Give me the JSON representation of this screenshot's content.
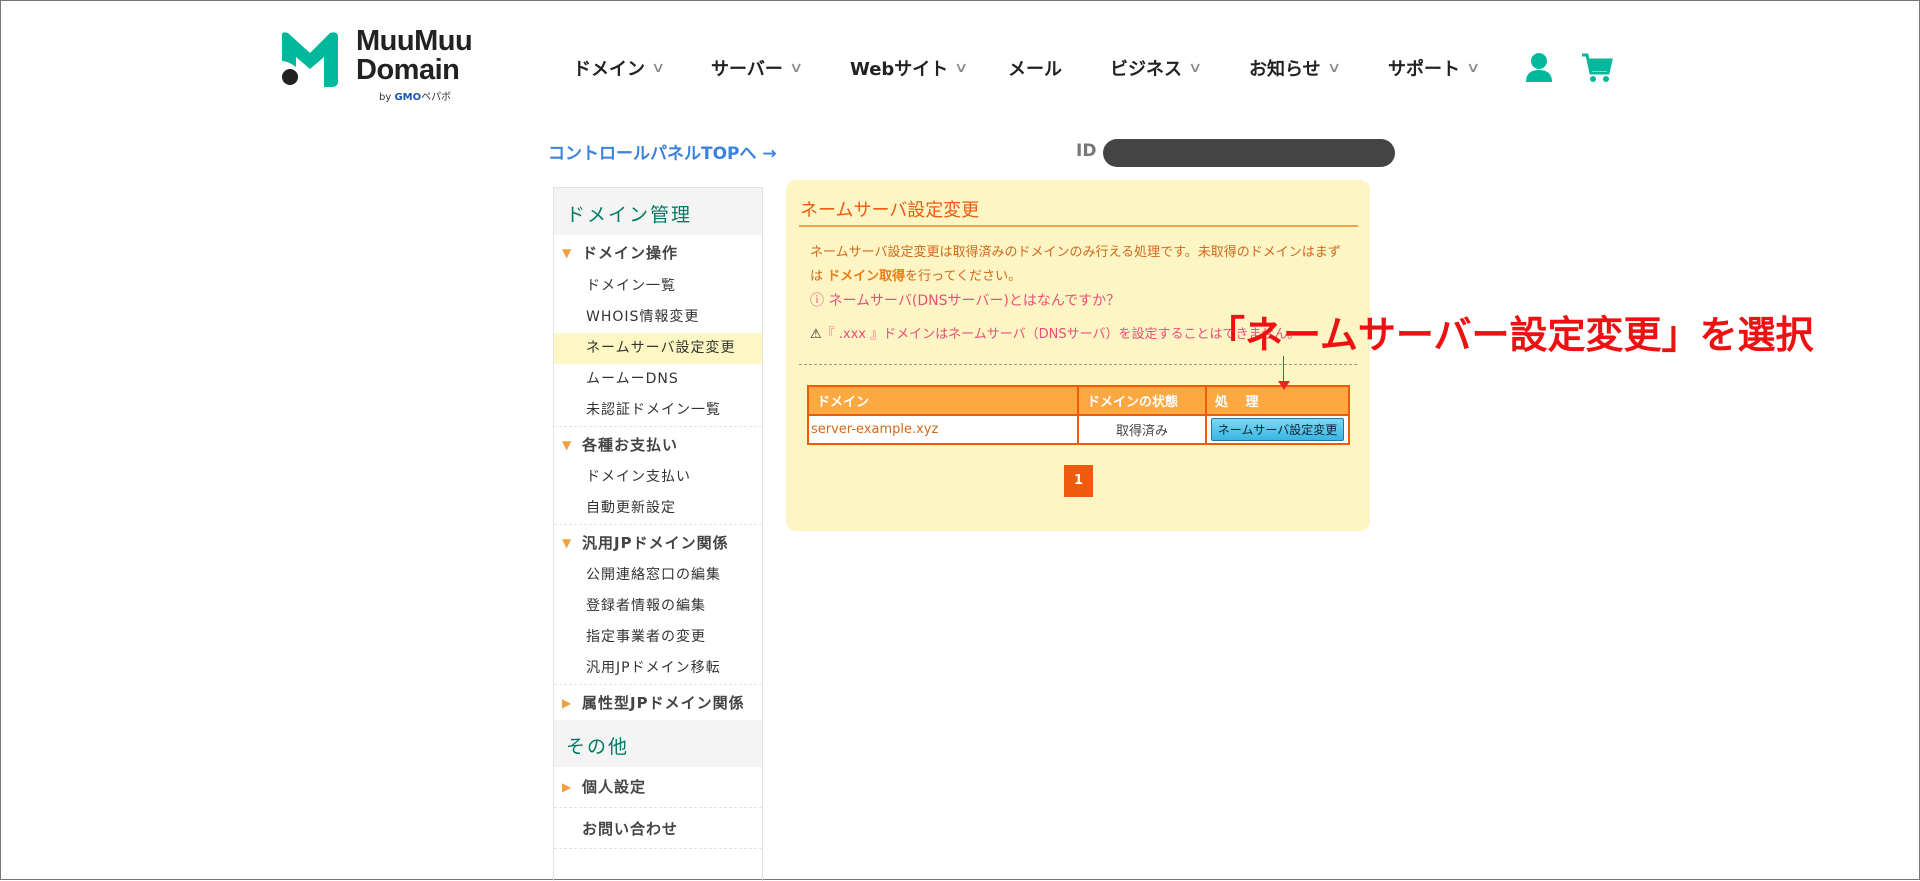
{
  "header": {
    "logo_line1": "MuuMuu",
    "logo_line2": "Domain",
    "logo_by": "by",
    "logo_gmo": "GMO",
    "logo_pepabo": "ペパボ",
    "nav": [
      {
        "label": "ドメイン",
        "dropdown": true
      },
      {
        "label": "サーバー",
        "dropdown": true
      },
      {
        "label": "Webサイト",
        "dropdown": true
      },
      {
        "label": "メール",
        "dropdown": false
      },
      {
        "label": "ビジネス",
        "dropdown": true
      },
      {
        "label": "お知らせ",
        "dropdown": true
      },
      {
        "label": "サポート",
        "dropdown": true
      }
    ],
    "chevron": "∨",
    "accent": "#00b89c"
  },
  "topbar": {
    "control_panel_link": "コントロールパネルTOPへ →",
    "id_label": "ID :"
  },
  "sidebar": {
    "heading1": "ドメイン管理",
    "sec1": "ドメイン操作",
    "sec1_items": [
      "ドメイン一覧",
      "WHOIS情報変更",
      "ネームサーバ設定変更",
      "ムームーDNS",
      "未認証ドメイン一覧"
    ],
    "sec2": "各種お支払い",
    "sec2_items": [
      "ドメイン支払い",
      "自動更新設定"
    ],
    "sec3": "汎用JPドメイン関係",
    "sec3_items": [
      "公開連絡窓口の編集",
      "登録者情報の編集",
      "指定事業者の変更",
      "汎用JPドメイン移転"
    ],
    "sec4": "属性型JPドメイン関係",
    "heading2": "その他",
    "sec5": "個人設定",
    "sec6": "お問い合わせ"
  },
  "panel": {
    "title": "ネームサーバ設定変更",
    "desc_1": "ネームサーバ設定変更は取得済みのドメインのみ行える処理です。未取得のドメインはまずは ",
    "desc_link": "ドメイン取得",
    "desc_2": "を行ってください。",
    "help_link": "ネームサーバ(DNSサーバー)とはなんですか？",
    "warning": "『 .xxx 』ドメインはネームサーバ（DNSサーバ）を設定することはできません。",
    "table": {
      "headers": [
        "ドメイン",
        "ドメインの状態",
        "処　 理"
      ],
      "rows": [
        {
          "domain": "server-example.xyz",
          "status": "取得済み",
          "action": "ネームサーバ設定変更"
        }
      ]
    },
    "page": "1"
  },
  "annotation": {
    "text": "「ネームサーバー設定変更」を選択",
    "arrow": "↓"
  }
}
